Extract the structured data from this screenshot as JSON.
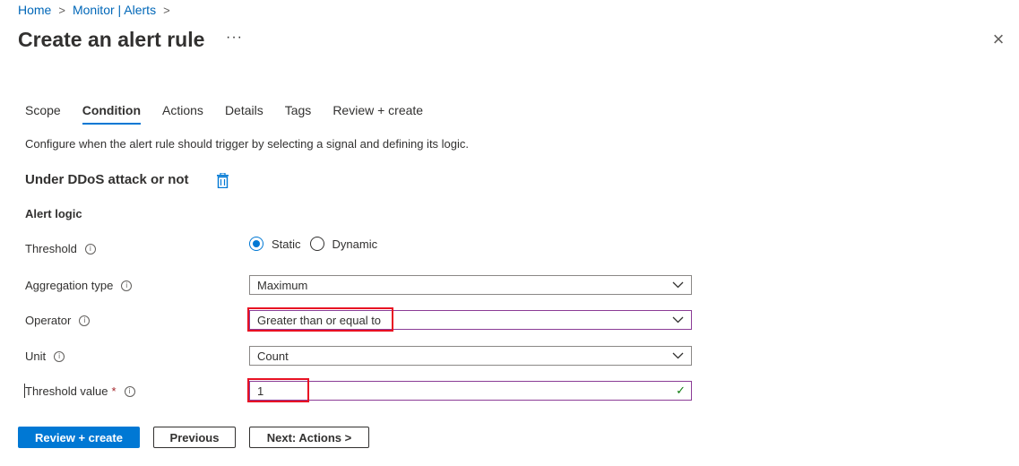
{
  "breadcrumb": [
    "Home",
    "Monitor | Alerts"
  ],
  "title": "Create an alert rule",
  "more_icon": "···",
  "close_icon": "×",
  "tabs": [
    "Scope",
    "Condition",
    "Actions",
    "Details",
    "Tags",
    "Review + create"
  ],
  "active_tab": "Condition",
  "description": "Configure when the alert rule should trigger by selecting a signal and defining its logic.",
  "signal_name": "Under DDoS attack or not",
  "section_title": "Alert logic",
  "fields": {
    "threshold": {
      "label": "Threshold",
      "options": [
        "Static",
        "Dynamic"
      ],
      "selected": "Static"
    },
    "aggregation": {
      "label": "Aggregation type",
      "value": "Maximum"
    },
    "operator": {
      "label": "Operator",
      "value": "Greater than or equal to"
    },
    "unit": {
      "label": "Unit",
      "value": "Count"
    },
    "threshold_value": {
      "label": "Threshold value",
      "required_mark": "*",
      "value": "1"
    }
  },
  "buttons": {
    "review": "Review + create",
    "previous": "Previous",
    "next": "Next: Actions >"
  },
  "colors": {
    "accent": "#0078d4",
    "highlight": "#e81123",
    "focus_border": "#8b3c96"
  }
}
